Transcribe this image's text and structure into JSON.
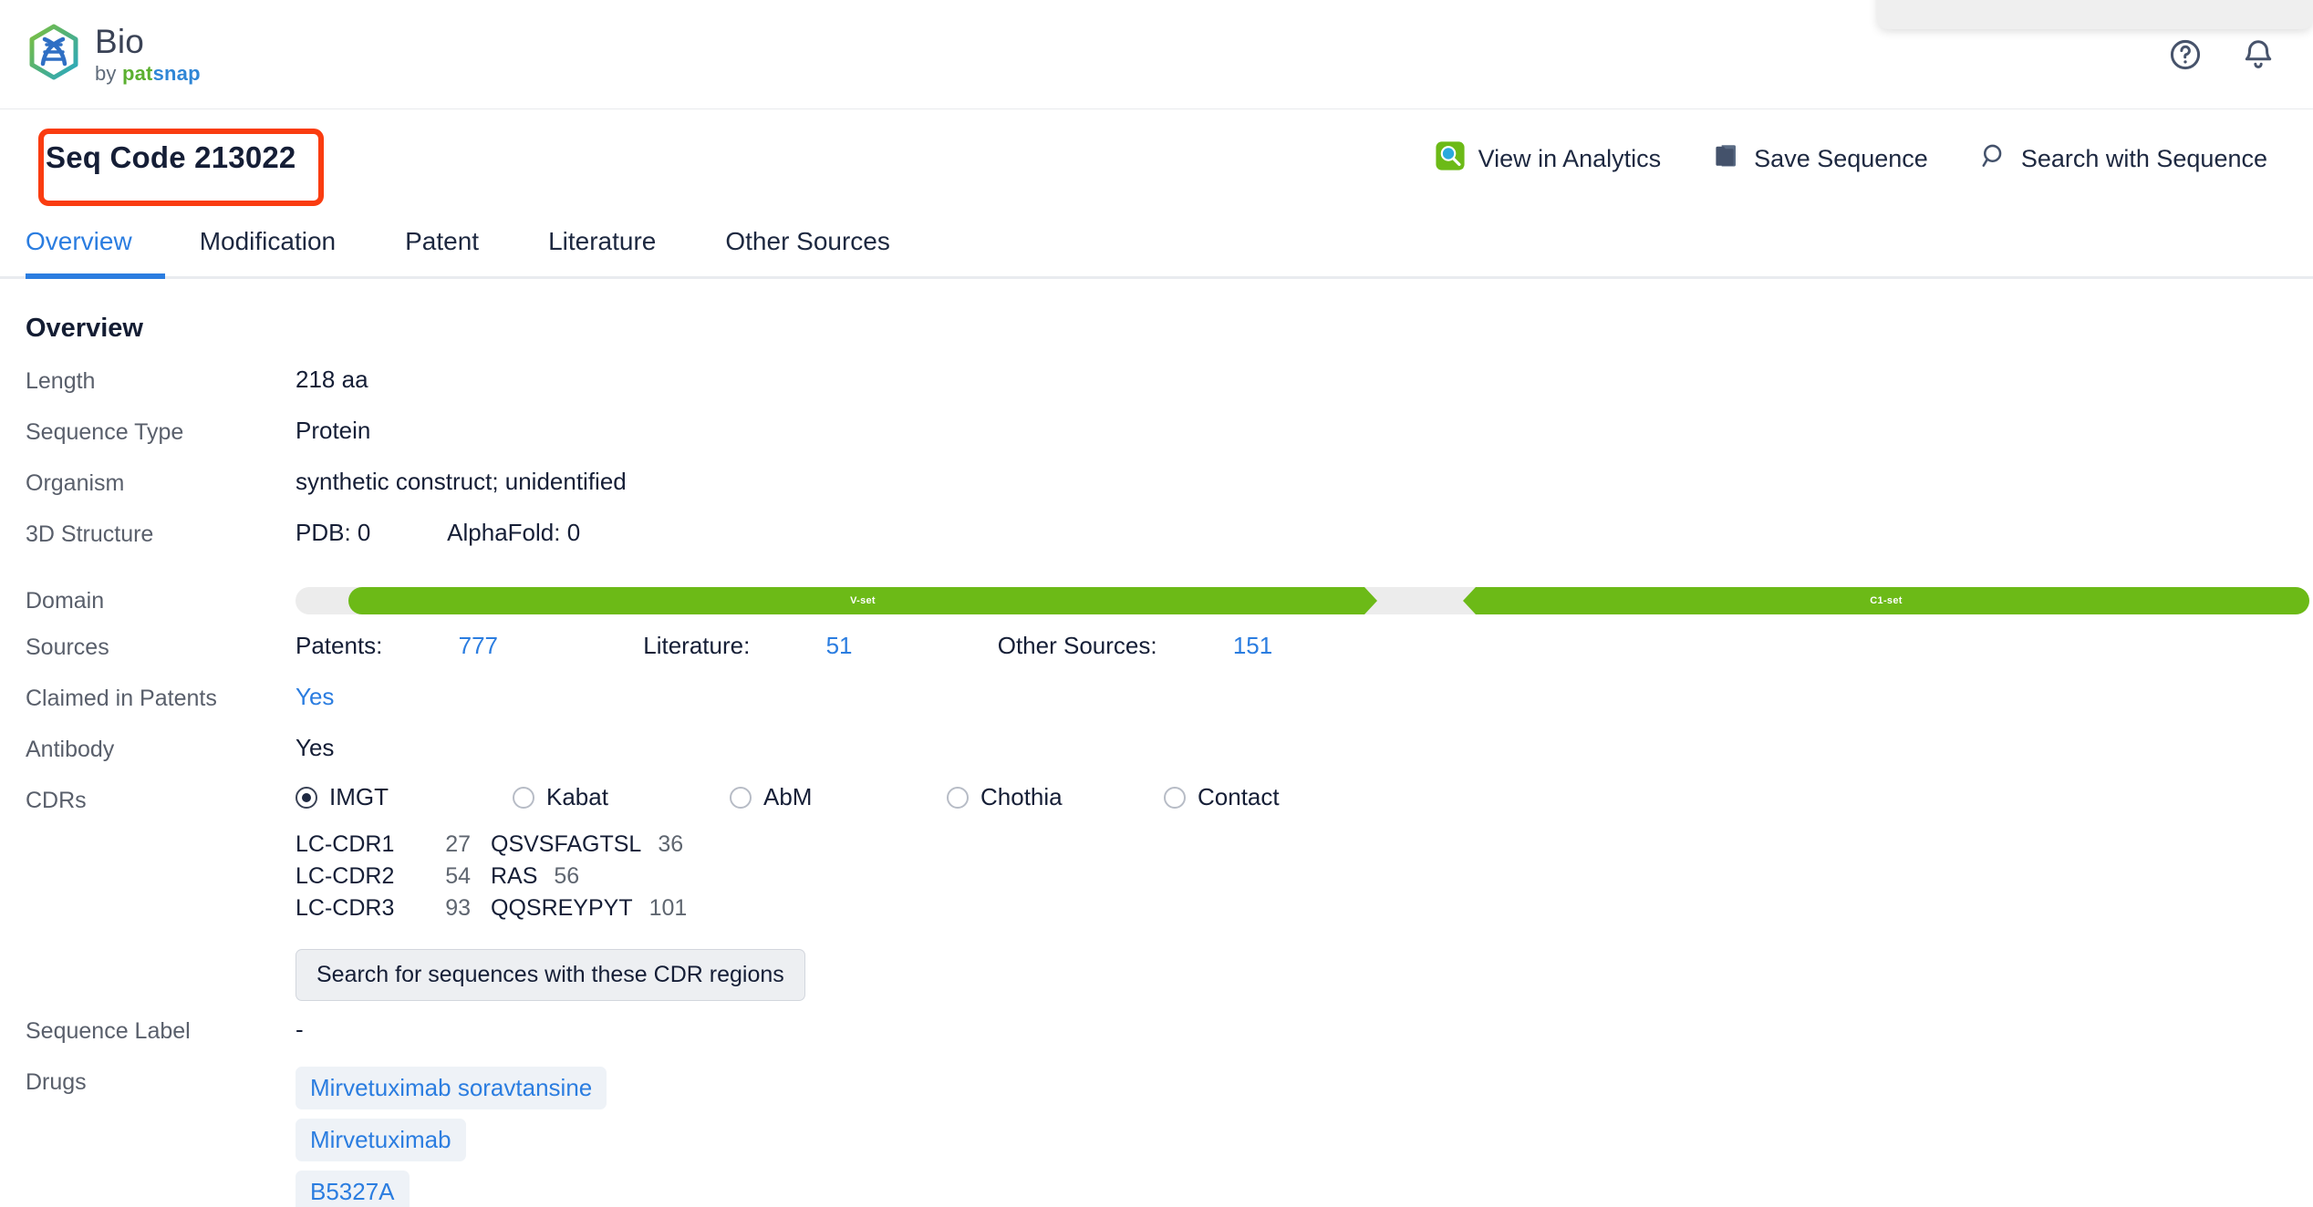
{
  "brand": {
    "name": "Bio",
    "by": "by",
    "pat": "pat",
    "snap": "snap",
    "logo_icon": "hexagon-dna-icon",
    "green": "#6cba17",
    "blue": "#2b7de0"
  },
  "topbar": {
    "help_icon": "help-circle-icon",
    "notifications_icon": "bell-icon"
  },
  "header": {
    "title": "Seq Code 213022",
    "highlight_color": "#fa3c10",
    "actions": [
      {
        "label": "View in Analytics",
        "icon": "analytics-search-icon"
      },
      {
        "label": "Save Sequence",
        "icon": "folder-icon"
      },
      {
        "label": "Search with Sequence",
        "icon": "search-icon"
      }
    ]
  },
  "tabs": [
    {
      "label": "Overview",
      "active": true
    },
    {
      "label": "Modification",
      "active": false
    },
    {
      "label": "Patent",
      "active": false
    },
    {
      "label": "Literature",
      "active": false
    },
    {
      "label": "Other Sources",
      "active": false
    }
  ],
  "overview": {
    "section_title": "Overview",
    "length": {
      "label": "Length",
      "value": "218 aa"
    },
    "sequence_type": {
      "label": "Sequence Type",
      "value": "Protein"
    },
    "organism": {
      "label": "Organism",
      "value": "synthetic construct; unidentified"
    },
    "structure": {
      "label": "3D Structure",
      "pdb": "PDB: 0",
      "alphafold": "AlphaFold: 0"
    },
    "domain": {
      "label": "Domain",
      "segments": [
        {
          "name": "V-set"
        },
        {
          "name": "C1-set"
        }
      ]
    },
    "sources": {
      "label": "Sources",
      "patents_label": "Patents:",
      "patents_value": "777",
      "literature_label": "Literature:",
      "literature_value": "51",
      "other_label": "Other Sources:",
      "other_value": "151"
    },
    "claimed": {
      "label": "Claimed in Patents",
      "value": "Yes"
    },
    "antibody": {
      "label": "Antibody",
      "value": "Yes"
    },
    "cdrs": {
      "label": "CDRs",
      "schemes": [
        {
          "name": "IMGT",
          "selected": true
        },
        {
          "name": "Kabat",
          "selected": false
        },
        {
          "name": "AbM",
          "selected": false
        },
        {
          "name": "Chothia",
          "selected": false
        },
        {
          "name": "Contact",
          "selected": false
        }
      ],
      "rows": [
        {
          "name": "LC-CDR1",
          "start": "27",
          "sequence": "QSVSFAGTSL",
          "end": "36"
        },
        {
          "name": "LC-CDR2",
          "start": "54",
          "sequence": "RAS",
          "end": "56"
        },
        {
          "name": "LC-CDR3",
          "start": "93",
          "sequence": "QQSREYPYT",
          "end": "101"
        }
      ],
      "search_button": "Search for sequences with these CDR regions"
    },
    "sequence_label": {
      "label": "Sequence Label",
      "value": "-"
    },
    "drugs": {
      "label": "Drugs",
      "items": [
        "Mirvetuximab soravtansine",
        "Mirvetuximab",
        "B5327A"
      ]
    }
  }
}
